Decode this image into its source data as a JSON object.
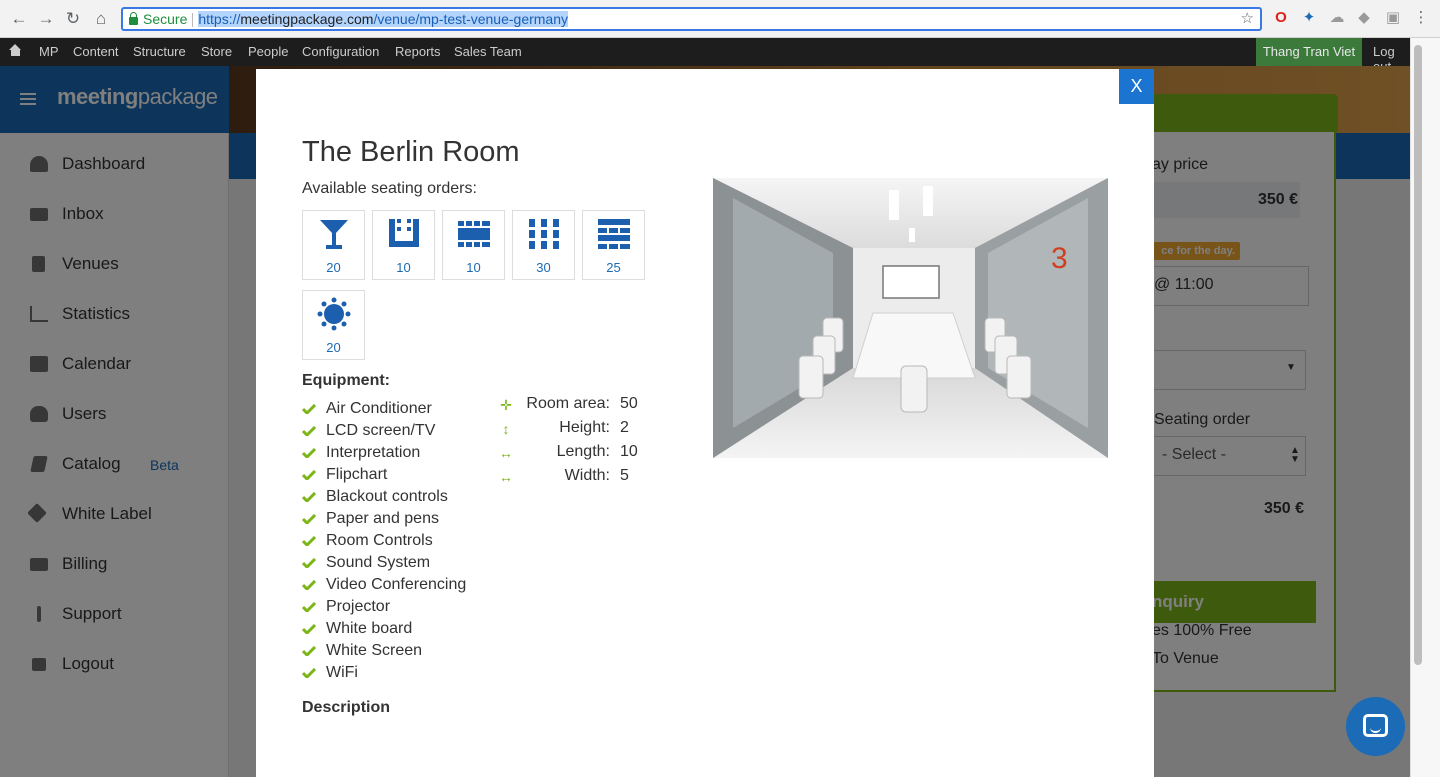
{
  "browser": {
    "secure_label": "Secure",
    "url_scheme": "https://",
    "url_host": "meetingpackage.com",
    "url_path": "/venue/mp-test-venue-germany"
  },
  "admin_bar": {
    "items": [
      "MP",
      "Content",
      "Structure",
      "Store",
      "People",
      "Configuration",
      "Reports",
      "Sales Team"
    ],
    "user": "Thang Tran Viet",
    "logout": "Log out"
  },
  "logo": {
    "part1": "meeting",
    "part2": "package"
  },
  "sidebar": {
    "items": [
      {
        "label": "Dashboard",
        "icon": "dashboard-icon"
      },
      {
        "label": "Inbox",
        "icon": "envelope-icon"
      },
      {
        "label": "Venues",
        "icon": "building-icon"
      },
      {
        "label": "Statistics",
        "icon": "line-chart-icon"
      },
      {
        "label": "Calendar",
        "icon": "calendar-icon"
      },
      {
        "label": "Users",
        "icon": "users-icon"
      },
      {
        "label": "Catalog",
        "icon": "book-icon"
      },
      {
        "label": "White Label",
        "icon": "plug-icon"
      },
      {
        "label": "Billing",
        "icon": "credit-card-icon"
      },
      {
        "label": "Support",
        "icon": "info-icon"
      },
      {
        "label": "Logout",
        "icon": "sign-out-icon"
      }
    ],
    "beta": "Beta"
  },
  "booking_panel": {
    "price_label": "ay price",
    "price_value": "350 €",
    "badge": "ce for the day.",
    "time_value": "@ 11:00",
    "seating_label": "Seating order",
    "seating_select": "- Select -",
    "total_value": "350 €",
    "inquiry_button": "nquiry",
    "free_text": "es 100% Free",
    "venue_text": "To Venue"
  },
  "modal": {
    "close_label": "X",
    "title": "The Berlin Room",
    "seating_label": "Available seating orders:",
    "seating": [
      {
        "icon": "cocktail-icon",
        "count": "20"
      },
      {
        "icon": "u-shape-icon",
        "count": "10"
      },
      {
        "icon": "boardroom-icon",
        "count": "10"
      },
      {
        "icon": "classroom-icon",
        "count": "30"
      },
      {
        "icon": "theater-icon",
        "count": "25"
      },
      {
        "icon": "banquet-icon",
        "count": "20"
      }
    ],
    "equipment_label": "Equipment:",
    "equipment": [
      "Air Conditioner",
      "LCD screen/TV",
      "Interpretation",
      "Flipchart",
      "Blackout controls",
      "Paper and pens",
      "Room Controls",
      "Sound System",
      "Video Conferencing",
      "Projector",
      "White board",
      "White Screen",
      "WiFi"
    ],
    "dimensions": [
      {
        "label": "Room area:",
        "value": "50",
        "icon": "area-icon"
      },
      {
        "label": "Height:",
        "value": "2",
        "icon": "height-icon"
      },
      {
        "label": "Length:",
        "value": "10",
        "icon": "length-icon"
      },
      {
        "label": "Width:",
        "value": "5",
        "icon": "width-icon"
      }
    ],
    "description_label": "Description"
  },
  "colors": {
    "brand_blue": "#1b6bb6",
    "accent_green": "#7cb518"
  }
}
